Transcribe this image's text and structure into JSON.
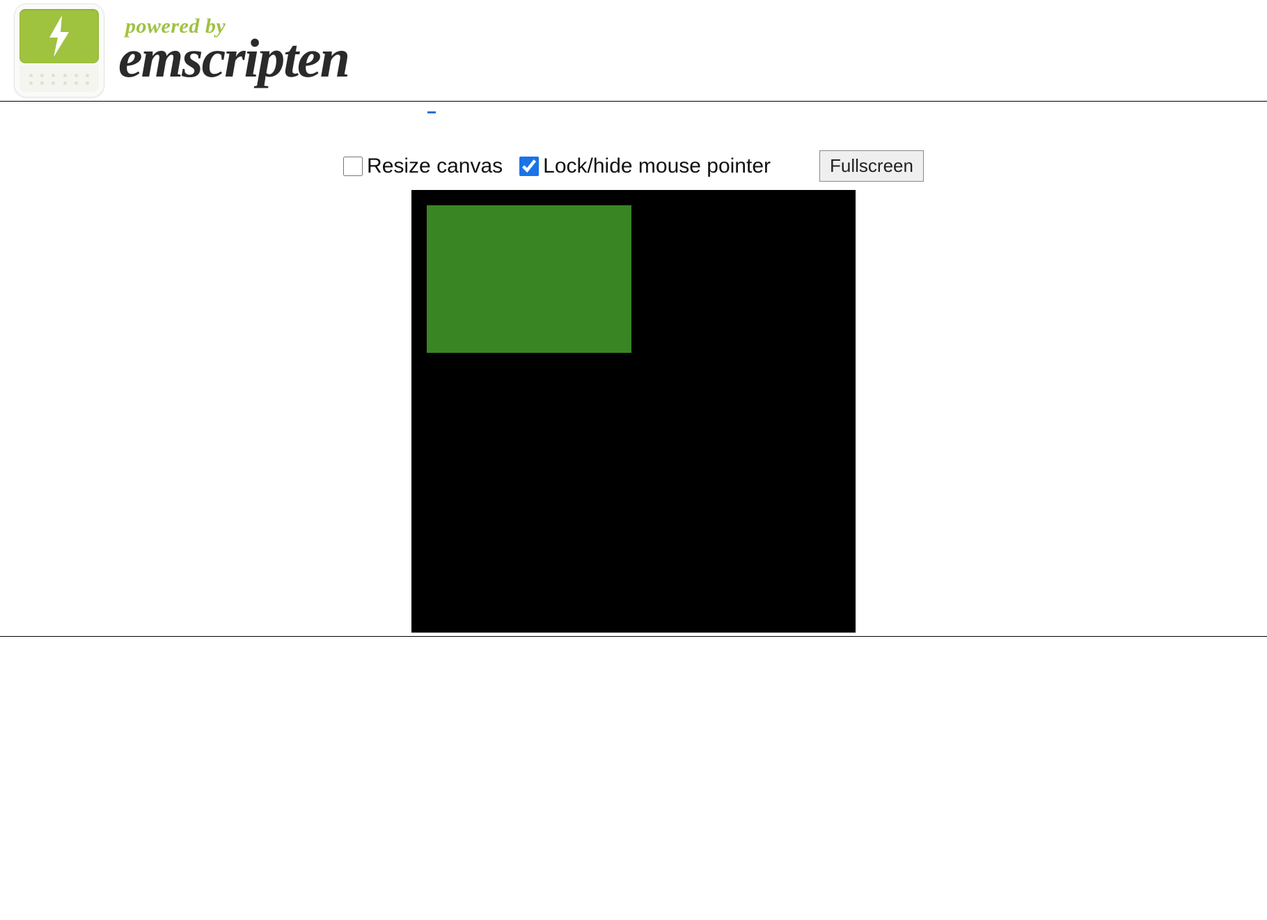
{
  "header": {
    "powered_by": "powered by",
    "title": "emscripten"
  },
  "controls": {
    "resize_label": "Resize canvas",
    "resize_checked": false,
    "lock_label": "Lock/hide mouse pointer",
    "lock_checked": true,
    "fullscreen_label": "Fullscreen"
  },
  "canvas": {
    "background_color": "#000000",
    "rect_color": "#3a8523"
  }
}
